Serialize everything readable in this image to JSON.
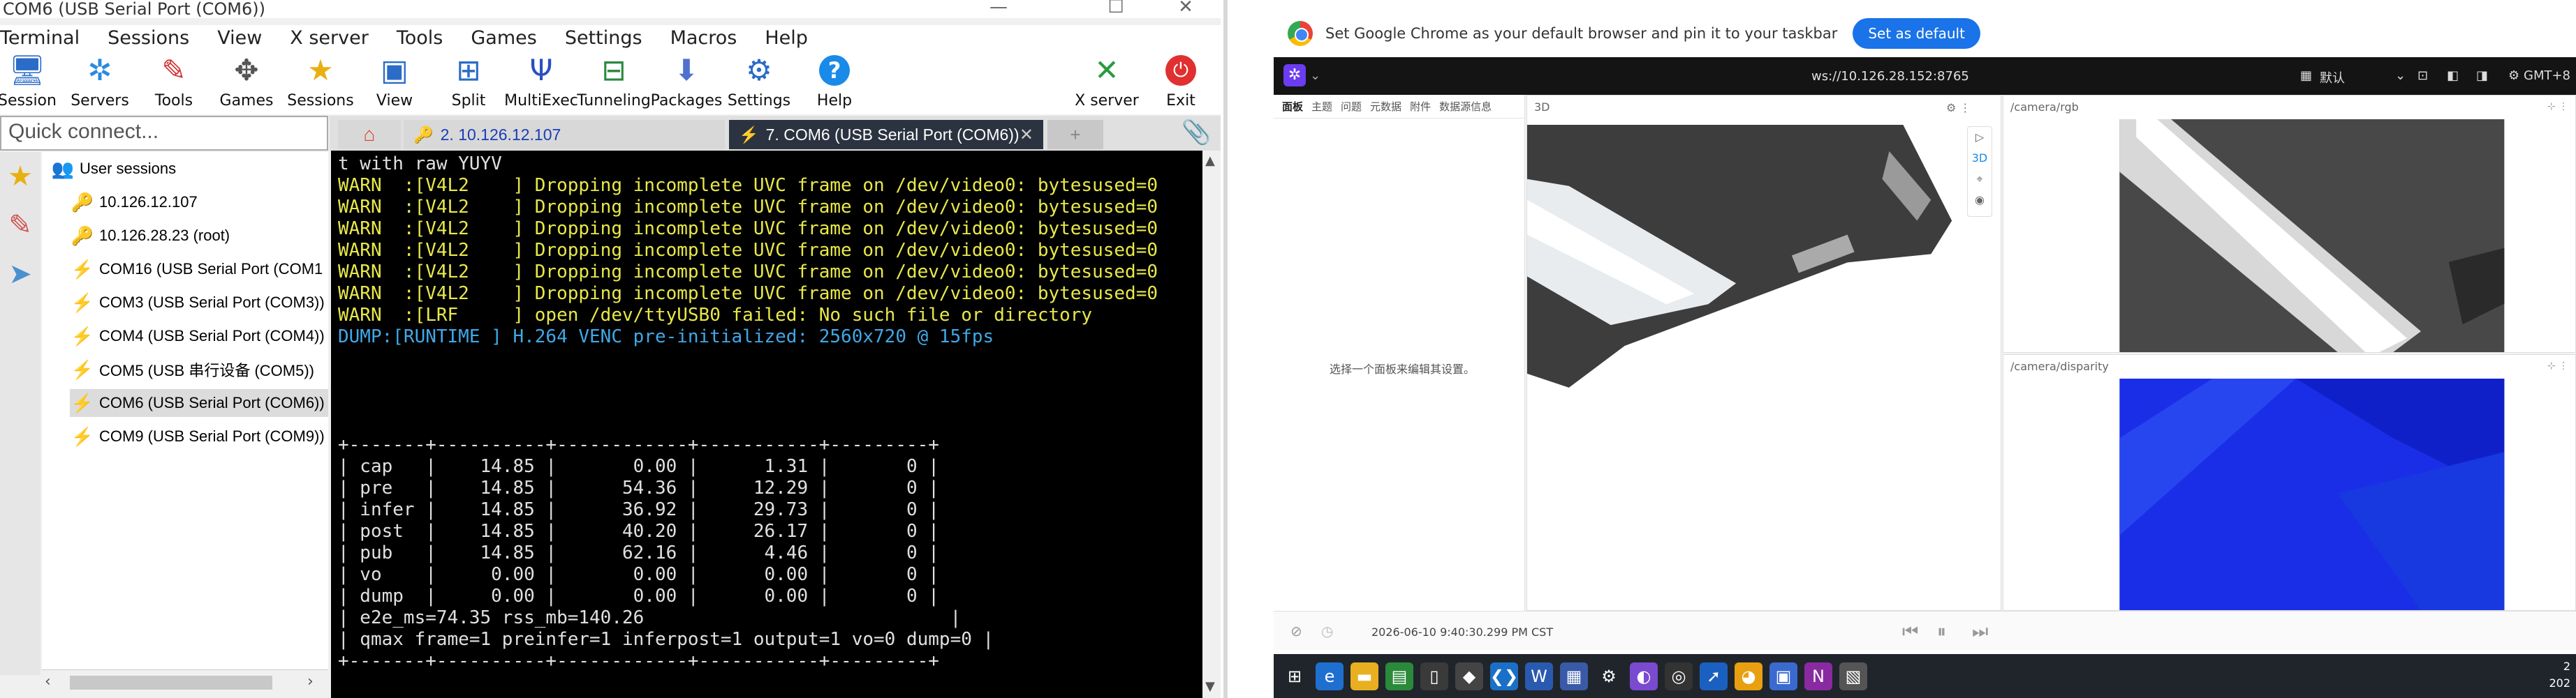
{
  "mobax": {
    "title": "COM6  (USB Serial Port (COM6))",
    "menu": [
      "Terminal",
      "Sessions",
      "View",
      "X server",
      "Tools",
      "Games",
      "Settings",
      "Macros",
      "Help"
    ],
    "toolbar": [
      "Session",
      "Servers",
      "Tools",
      "Games",
      "Sessions",
      "View",
      "Split",
      "MultiExec",
      "Tunneling",
      "Packages",
      "Settings",
      "Help",
      "X server",
      "Exit"
    ],
    "quick_connect": "Quick connect...",
    "tree": {
      "root": "User sessions",
      "items": [
        "10.126.12.107",
        "10.126.28.23 (root)",
        "COM16  (USB Serial Port (COM1",
        "COM3  (USB Serial Port (COM3))",
        "COM4  (USB Serial Port (COM4))",
        "COM5  (USB 串行设备 (COM5))",
        "COM6  (USB Serial Port (COM6))",
        "COM9  (USB Serial Port (COM9))"
      ]
    },
    "tabs": {
      "t2": "2. 10.126.12.107",
      "t7": "7. COM6  (USB Serial Port (COM6))"
    },
    "terminal": [
      {
        "c": "cw",
        "t": "t with raw YUYV"
      },
      {
        "c": "cy",
        "t": "WARN  :[V4L2    ] Dropping incomplete UVC frame on /dev/video0: bytesused=0"
      },
      {
        "c": "cy",
        "t": "WARN  :[V4L2    ] Dropping incomplete UVC frame on /dev/video0: bytesused=0"
      },
      {
        "c": "cy",
        "t": "WARN  :[V4L2    ] Dropping incomplete UVC frame on /dev/video0: bytesused=0"
      },
      {
        "c": "cy",
        "t": "WARN  :[V4L2    ] Dropping incomplete UVC frame on /dev/video0: bytesused=0"
      },
      {
        "c": "cy",
        "t": "WARN  :[V4L2    ] Dropping incomplete UVC frame on /dev/video0: bytesused=0"
      },
      {
        "c": "cy",
        "t": "WARN  :[V4L2    ] Dropping incomplete UVC frame on /dev/video0: bytesused=0"
      },
      {
        "c": "cy",
        "t": "WARN  :[LRF     ] open /dev/ttyUSB0 failed: No such file or directory"
      },
      {
        "c": "cc",
        "t": "DUMP:[RUNTIME ] H.264 VENC pre-initialized: 2560x720 @ 15fps"
      },
      {
        "c": "cw",
        "t": ""
      },
      {
        "c": "cw",
        "t": ""
      },
      {
        "c": "cw",
        "t": ""
      },
      {
        "c": "cw",
        "t": ""
      },
      {
        "c": "cw",
        "t": "+-------+----------+------------+-----------+---------+"
      },
      {
        "c": "cw",
        "t": "| cap   |    14.85 |       0.00 |      1.31 |       0 |"
      },
      {
        "c": "cw",
        "t": "| pre   |    14.85 |      54.36 |     12.29 |       0 |"
      },
      {
        "c": "cw",
        "t": "| infer |    14.85 |      36.92 |     29.73 |       0 |"
      },
      {
        "c": "cw",
        "t": "| post  |    14.85 |      40.20 |     26.17 |       0 |"
      },
      {
        "c": "cw",
        "t": "| pub   |    14.85 |      62.16 |      4.46 |       0 |"
      },
      {
        "c": "cw",
        "t": "| vo    |     0.00 |       0.00 |      0.00 |       0 |"
      },
      {
        "c": "cw",
        "t": "| dump  |     0.00 |       0.00 |      0.00 |       0 |"
      },
      {
        "c": "cw",
        "t": "| e2e_ms=74.35 rss_mb=140.26                            |"
      },
      {
        "c": "cw",
        "t": "| qmax frame=1 preinfer=1 inferpost=1 output=1 vo=0 dump=0 |"
      },
      {
        "c": "cw",
        "t": "+-------+----------+------------+-----------+---------+"
      }
    ]
  },
  "chrome_bar": {
    "message": "Set Google Chrome as your default browser and pin it to your taskbar",
    "button": "Set as default"
  },
  "foxglove": {
    "url": "ws://10.126.28.152:8765",
    "layout_label": "默认",
    "timezone": "GMT+8",
    "left_tabs": [
      "面板",
      "主题",
      "问题",
      "元数据",
      "附件",
      "数据源信息"
    ],
    "hint": "选择一个面板来编辑其设置。",
    "panel_3d": "3D",
    "panel_rgb": "/camera/rgb",
    "panel_disp": "/camera/disparity",
    "timestamp": "2026-06-10 9:40:30.299 PM CST"
  },
  "taskbar": {
    "clock_line1": "2",
    "clock_line2": "202"
  }
}
